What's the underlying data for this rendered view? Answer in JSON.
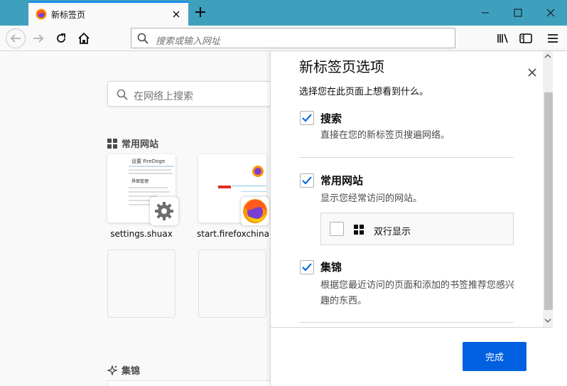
{
  "tab": {
    "title": "新标签页"
  },
  "urlbar": {
    "placeholder": "搜索或输入网址"
  },
  "page": {
    "search_placeholder": "在网络上搜索",
    "top_sites_title": "常用网站",
    "highlights_title": "集锦",
    "tiles": [
      {
        "label": "settings.shuax",
        "preview_title": "设置 FireDoge",
        "preview_heading": "界面管理"
      },
      {
        "label": "start.firefoxchina"
      }
    ]
  },
  "panel": {
    "title": "新标签页选项",
    "subtitle": "选择您在此页面上想看到什么。",
    "options": [
      {
        "label": "搜索",
        "desc": "直接在您的新标签页搜遍网络。",
        "checked": true
      },
      {
        "label": "常用网站",
        "desc": "显示您经常访问的网站。",
        "checked": true
      },
      {
        "label": "集锦",
        "desc": "根据您最近访问的页面和添加的书签推荐您感兴趣的东西。",
        "checked": true
      }
    ],
    "sub_option": {
      "label": "双行显示",
      "checked": false
    },
    "done_label": "完成"
  },
  "colors": {
    "accent": "#0a84ff",
    "titlebar": "#3ea0bd",
    "primary_button": "#0060df"
  },
  "icons": [
    "firefox-icon",
    "close-icon",
    "plus-icon",
    "back-icon",
    "forward-icon",
    "reload-icon",
    "home-icon",
    "search-icon",
    "library-icon",
    "sidebar-icon",
    "hamburger-menu-icon",
    "grid-icon",
    "sparkle-icon",
    "gear-icon",
    "check-icon"
  ]
}
